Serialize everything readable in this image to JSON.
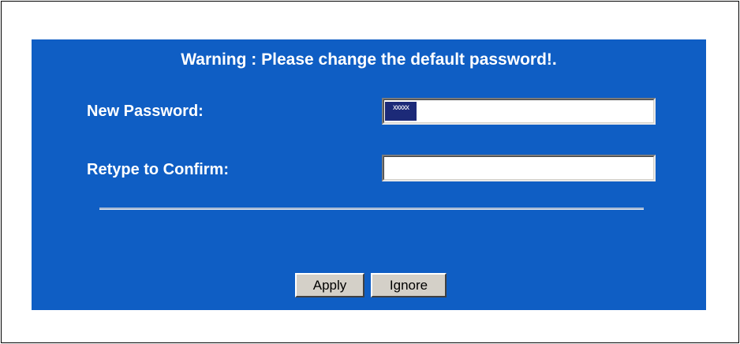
{
  "dialog": {
    "warning": "Warning : Please change the default password!.",
    "new_password_label": "New Password:",
    "new_password_value": "ххххх",
    "retype_label": "Retype to Confirm:",
    "retype_value": "",
    "apply_label": "Apply",
    "ignore_label": "Ignore"
  },
  "colors": {
    "panel_background": "#0f5ec4",
    "button_face": "#d4d0c8",
    "selection": "#1c2a78"
  }
}
